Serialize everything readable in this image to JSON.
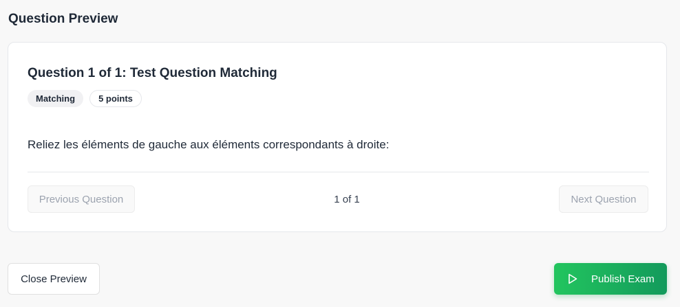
{
  "header": {
    "title": "Question Preview"
  },
  "question": {
    "title": "Question 1 of 1: Test Question Matching",
    "type_badge": "Matching",
    "points_badge": "5 points",
    "prompt": "Reliez les éléments de gauche aux éléments correspondants à droite:"
  },
  "navigation": {
    "previous_label": "Previous Question",
    "counter": "1 of 1",
    "next_label": "Next Question"
  },
  "footer": {
    "close_label": "Close Preview",
    "publish_label": "Publish Exam",
    "publish_icon": "play-icon"
  },
  "colors": {
    "accent": "#22c55e",
    "accent_dark": "#139a5c",
    "background": "#f8f8f8"
  }
}
